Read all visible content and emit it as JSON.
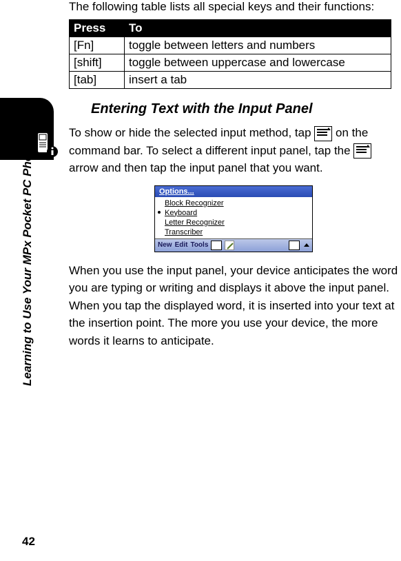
{
  "sideLabel": "Learning to Use Your MPx Pocket PC Phone",
  "pageNumber": "42",
  "introText": "The following table lists all special keys and their functions:",
  "table": {
    "headers": {
      "col1": "Press",
      "col2": "To"
    },
    "rows": [
      {
        "press": "[Fn]",
        "to": "toggle between letters and numbers"
      },
      {
        "press": "[shift]",
        "to": "toggle between uppercase and lowercase"
      },
      {
        "press": "[tab]",
        "to": "insert a tab"
      }
    ]
  },
  "sectionHeading": "Entering Text with the Input Panel",
  "para1": {
    "seg1": "To show or hide the selected input method, tap ",
    "seg2": " on the command bar. To select a different input panel, tap the ",
    "seg3": " arrow and then tap the input panel that you want."
  },
  "panel": {
    "optionsLabel": "Options...",
    "items": {
      "block": "Block Recognizer",
      "keyboard": "Keyboard",
      "letter": "Letter Recognizer",
      "transcriber": "Transcriber"
    },
    "bar": {
      "new": "New",
      "edit": "Edit",
      "tools": "Tools"
    }
  },
  "para2": "When you use the input panel, your device anticipates the word you are typing or writing and displays it above the input panel. When you tap the displayed word, it is inserted into your text at the insertion point. The more you use your device, the more words it learns to anticipate."
}
